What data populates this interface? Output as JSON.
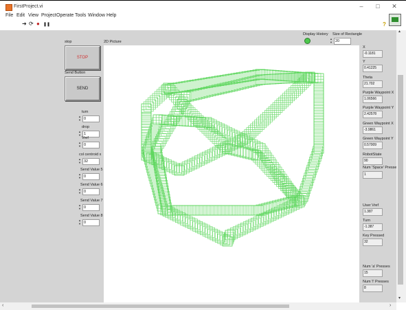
{
  "window": {
    "title": "FirstProject.vi",
    "minimize": "–",
    "maximize": "□",
    "close": "✕"
  },
  "menu": [
    "File",
    "Edit",
    "View",
    "Project",
    "Operate",
    "Tools",
    "Window",
    "Help"
  ],
  "toolbar": {
    "run": "➜",
    "run_continuous": "⟳",
    "abort": "●",
    "pause": "❚❚",
    "help": "?"
  },
  "controls": {
    "stop": {
      "label": "stop",
      "button": "STOP"
    },
    "send_button": {
      "label": "Send Button",
      "button": "SEND"
    },
    "picture_label": "2D Picture",
    "display_history": {
      "label": "Display History",
      "led_color": "#4cc84c"
    },
    "size_of_rectangle": {
      "label": "Size of Rectangle",
      "value": "20"
    },
    "numeric": [
      {
        "label": "turn",
        "value": "0"
      },
      {
        "label": "drop",
        "value": "1"
      },
      {
        "label": "Vref",
        "value": "0"
      },
      {
        "label": "col centroid x",
        "value": "32"
      },
      {
        "label": "Send Value 5",
        "value": "0"
      },
      {
        "label": "Send Value 6",
        "value": "0"
      },
      {
        "label": "Send Value 7",
        "value": "0"
      },
      {
        "label": "Send Value 8",
        "value": "0"
      }
    ]
  },
  "indicators": [
    {
      "label": "X",
      "value": "-0.1181"
    },
    {
      "label": "Y",
      "value": "0.41225"
    },
    {
      "label": "Theta",
      "value": "21.702"
    },
    {
      "label": "Purple Waypoint X",
      "value": "1.06566"
    },
    {
      "label": "Purple Waypoint Y",
      "value": "2.42578"
    },
    {
      "label": "Green Waypoint X",
      "value": "-3.9861"
    },
    {
      "label": "Green Waypoint Y",
      "value": "0.57009"
    },
    {
      "label": "RobotState",
      "value": "90"
    },
    {
      "label": "Num 'Space' Presses",
      "value": "1"
    },
    {
      "label": "User Vref",
      "value": "1.387"
    },
    {
      "label": "Turn",
      "value": "-1.387"
    },
    {
      "label": "Key Pressed",
      "value": "32"
    },
    {
      "label": "Num 'a' Presses",
      "value": "15"
    },
    {
      "label": "Num 'l' Presses",
      "value": "8"
    }
  ],
  "picture": {
    "stroke_color": "#5cd65c"
  }
}
